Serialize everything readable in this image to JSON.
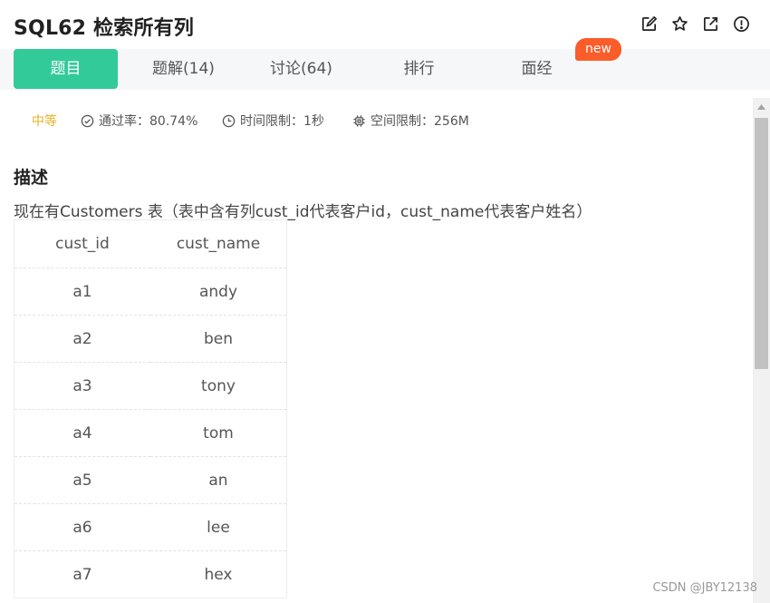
{
  "header": {
    "title": "SQL62  检索所有列",
    "icons": [
      "edit-icon",
      "star-icon",
      "open-external-icon",
      "info-icon"
    ]
  },
  "tabs": [
    {
      "label": "题目",
      "active": true
    },
    {
      "label": "题解(14)",
      "active": false
    },
    {
      "label": "讨论(64)",
      "active": false
    },
    {
      "label": "排行",
      "active": false
    },
    {
      "label": "面经",
      "active": false
    }
  ],
  "badge": {
    "label": "new",
    "color": "#fa5c2a"
  },
  "meta": {
    "difficulty": "中等",
    "pass_rate": "通过率：80.74%",
    "time_limit": "时间限制：1秒",
    "memory_limit": "空间限制：256M"
  },
  "description": {
    "heading": "描述",
    "text": "现在有Customers 表（表中含有列cust_id代表客户id，cust_name代表客户姓名）"
  },
  "table": {
    "columns": [
      "cust_id",
      "cust_name"
    ],
    "rows": [
      [
        "a1",
        "andy"
      ],
      [
        "a2",
        "ben"
      ],
      [
        "a3",
        "tony"
      ],
      [
        "a4",
        "tom"
      ],
      [
        "a5",
        "an"
      ],
      [
        "a6",
        "lee"
      ],
      [
        "a7",
        "hex"
      ]
    ]
  },
  "watermark": "CSDN @JBY12138",
  "colors": {
    "accent": "#32ca99",
    "difficulty": "#e9b124",
    "badge": "#fa5c2a"
  }
}
